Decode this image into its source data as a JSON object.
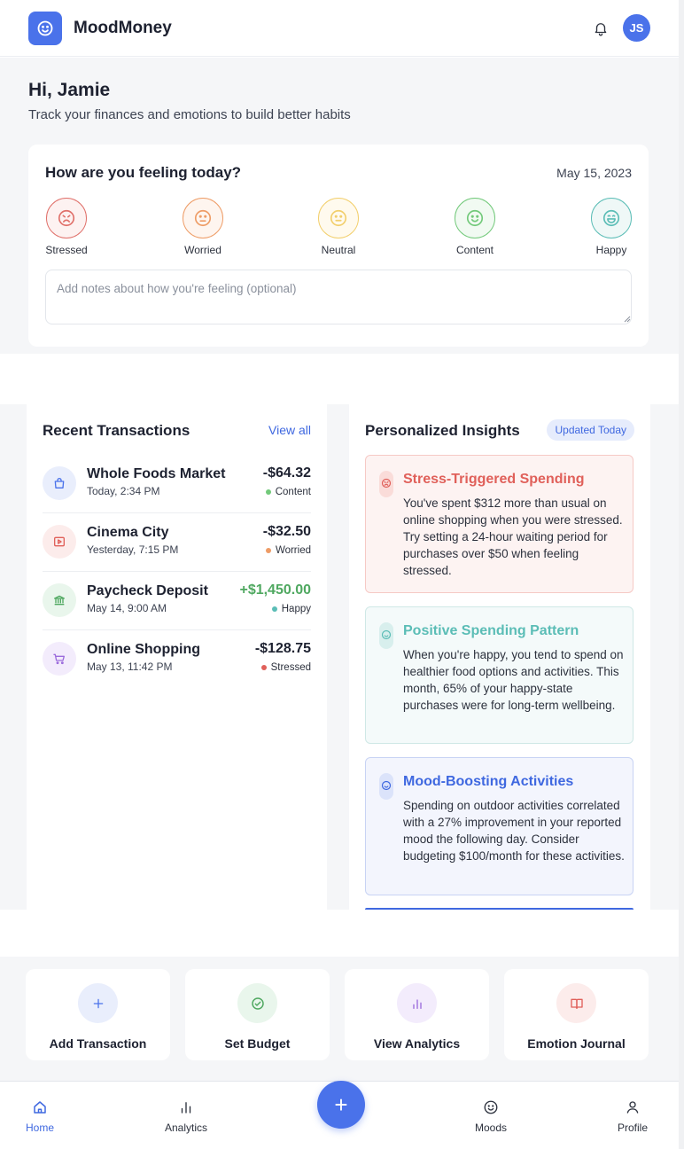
{
  "app": {
    "name": "MoodMoney",
    "logo_icon": "smile-icon",
    "user_initials": "JS",
    "accent": "#4a72ea"
  },
  "greeting": {
    "title": "Hi, Jamie",
    "subtitle": "Track your finances and emotions to build better habits"
  },
  "mood_checkin": {
    "title": "How are you feeling today?",
    "date": "May 15, 2023",
    "options": [
      {
        "label": "Stressed",
        "icon": "frown-icon",
        "color": "#e0706a"
      },
      {
        "label": "Worried",
        "icon": "neutral-face-icon",
        "color": "#ee9c66"
      },
      {
        "label": "Neutral",
        "icon": "neutral-face-icon",
        "color": "#f2cf6c"
      },
      {
        "label": "Content",
        "icon": "smile-icon",
        "color": "#72c97a"
      },
      {
        "label": "Happy",
        "icon": "laugh-icon",
        "color": "#5bbdb6"
      }
    ],
    "notes_placeholder": "Add notes about how you're feeling (optional)"
  },
  "transactions": {
    "title": "Recent Transactions",
    "view_all": "View all",
    "items": [
      {
        "name": "Whole Foods Market",
        "time": "Today, 2:34 PM",
        "amount": "-$64.32",
        "mood": "Content",
        "mood_color": "#72c97a",
        "icon": "shopping-bag-icon",
        "icon_color": "#4a72ea",
        "icon_bg": "#e9eefc"
      },
      {
        "name": "Cinema City",
        "time": "Yesterday, 7:15 PM",
        "amount": "-$32.50",
        "mood": "Worried",
        "mood_color": "#ee9c66",
        "icon": "film-icon",
        "icon_color": "#e0605a",
        "icon_bg": "#fceceb"
      },
      {
        "name": "Paycheck Deposit",
        "time": "May 14, 9:00 AM",
        "amount": "+$1,450.00",
        "mood": "Happy",
        "mood_color": "#5bbdb6",
        "icon": "bank-icon",
        "icon_color": "#4fa860",
        "icon_bg": "#e9f6ec"
      },
      {
        "name": "Online Shopping",
        "time": "May 13, 11:42 PM",
        "amount": "-$128.75",
        "mood": "Stressed",
        "mood_color": "#e0605a",
        "icon": "cart-icon",
        "icon_color": "#9b6bdc",
        "icon_bg": "#f3ecfc"
      }
    ]
  },
  "insights": {
    "title": "Personalized Insights",
    "badge": "Updated Today",
    "items": [
      {
        "title": "Stress-Triggered Spending",
        "text": "You've spent $312 more than usual on online shopping when you were stressed. Try setting a 24-hour waiting period for purchases over $50 when feeling stressed.",
        "color": "#e0605a",
        "bg": "#fdf3f2",
        "border": "#f6c9c5",
        "icon": "frown-icon"
      },
      {
        "title": "Positive Spending Pattern",
        "text": "When you're happy, you tend to spend on healthier food options and activities. This month, 65% of your happy-state purchases were for long-term wellbeing.",
        "color": "#5bbdb6",
        "bg": "#f4fafa",
        "border": "#cfe8e6",
        "icon": "smile-icon"
      },
      {
        "title": "Mood-Boosting Activities",
        "text": "Spending on outdoor activities correlated with a 27% improvement in your reported mood the following day. Consider budgeting $100/month for these activities.",
        "color": "#3f68e0",
        "bg": "#f3f5fd",
        "border": "#c8d3f4",
        "icon": "smile-icon"
      }
    ]
  },
  "quick_actions": [
    {
      "label": "Add Transaction",
      "icon": "plus-icon",
      "color": "#4a72ea",
      "bg": "#e9eefc"
    },
    {
      "label": "Set Budget",
      "icon": "check-circle-icon",
      "color": "#4fa860",
      "bg": "#e9f6ec"
    },
    {
      "label": "View Analytics",
      "icon": "bar-chart-icon",
      "color": "#9b6bdc",
      "bg": "#f3ecfc"
    },
    {
      "label": "Emotion Journal",
      "icon": "book-icon",
      "color": "#e0605a",
      "bg": "#fceceb"
    }
  ],
  "nav": {
    "items": [
      {
        "label": "Home",
        "icon": "home-icon",
        "active": true
      },
      {
        "label": "Analytics",
        "icon": "bar-chart-icon",
        "active": false
      },
      {
        "label": "Moods",
        "icon": "smile-icon",
        "active": false
      },
      {
        "label": "Profile",
        "icon": "user-icon",
        "active": false
      }
    ],
    "fab_label": "+"
  }
}
